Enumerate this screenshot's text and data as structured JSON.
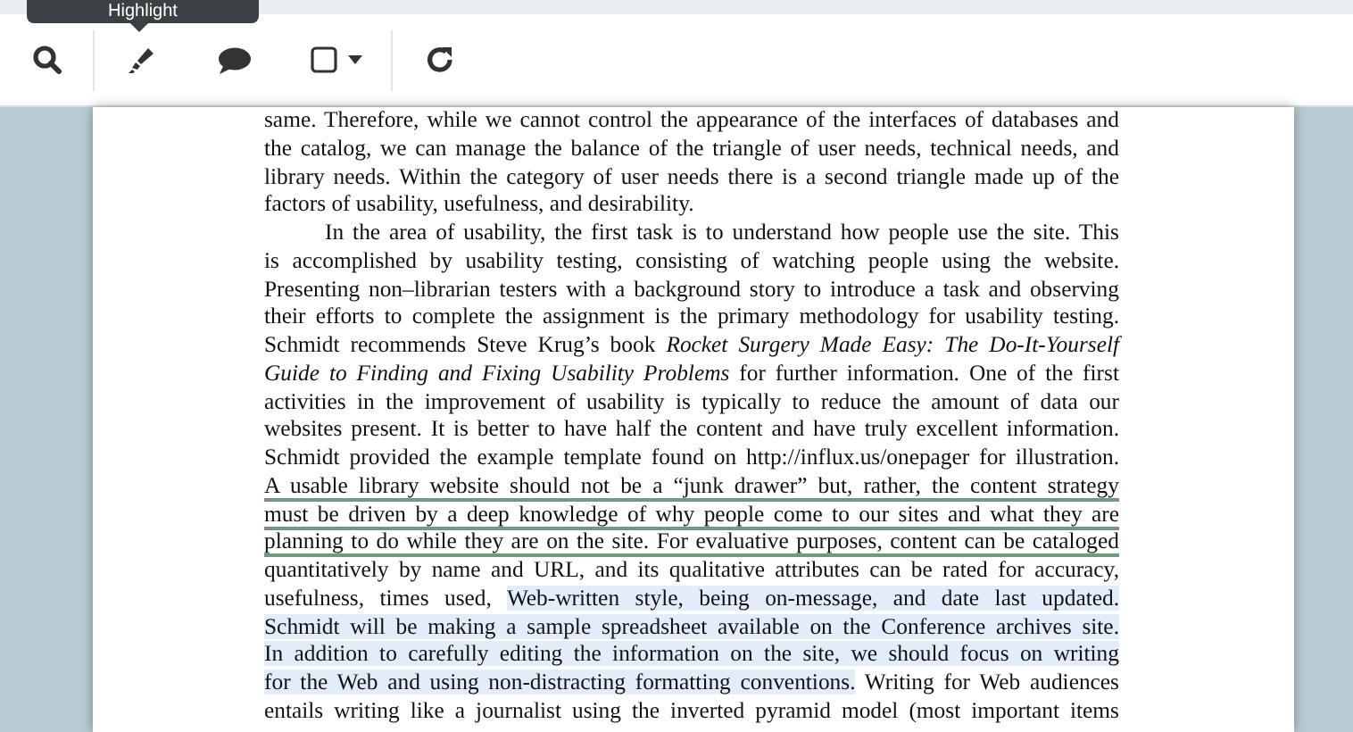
{
  "toolbar": {
    "tools": [
      {
        "kind": "search"
      },
      {
        "kind": "divider"
      },
      {
        "kind": "highlight",
        "tooltip": "Highlight"
      },
      {
        "kind": "comment"
      },
      {
        "kind": "shape"
      },
      {
        "kind": "divider"
      },
      {
        "kind": "refresh"
      }
    ]
  },
  "paragraphs": [
    {
      "indented": false,
      "lines": [
        [
          {
            "text": "same. Therefore, while we cannot control the appearance of the interfaces of databases and"
          }
        ],
        [
          {
            "text": "the catalog, we can manage the balance of the triangle of user needs, technical needs, and"
          }
        ],
        [
          {
            "text": "library needs. Within the category of user needs there is a second triangle made up of the"
          }
        ],
        [
          {
            "text": "factors of usability, usefulness, and desirability."
          }
        ]
      ]
    },
    {
      "indented": true,
      "lines": [
        [
          {
            "text": "In the area of usability, the first task is to understand how people use the site. This"
          }
        ],
        [
          {
            "text": "is accomplished by usability testing, consisting of watching people using the website."
          }
        ],
        [
          {
            "text": "Presenting non–librarian testers with a background story to introduce a task and observing"
          }
        ],
        [
          {
            "text": "their efforts to complete the assignment is the primary methodology for usability testing."
          }
        ],
        [
          {
            "text": "Schmidt recommends Steve Krug’s book *Rocket Surgery Made Easy: The Do-It-Yourself*"
          }
        ],
        [
          {
            "text": "*Guide to Finding and Fixing Usability Problems* for further information. One of the first"
          }
        ],
        [
          {
            "text": "activities in the improvement of usability is typically to reduce the amount of data our"
          }
        ],
        [
          {
            "text": "websites present. It is better to have half the content and have truly excellent information."
          }
        ],
        [
          {
            "text": "Schmidt provided the example template found on http://influx.us/onepager for illustration."
          }
        ],
        [
          {
            "text": "A usable library website should not be a “junk drawer” but, rather, the content strategy",
            "underlined": true
          }
        ],
        [
          {
            "text": "must be driven by a deep knowledge of why people come to our sites and what they are",
            "underlined": true
          }
        ],
        [
          {
            "text": "planning to do while they are on the site. For evaluative purposes, content can be cataloged",
            "underlined": true
          }
        ],
        [
          {
            "text": "quantitatively by name and URL, and its qualitative attributes can be rated for accuracy,"
          }
        ],
        [
          {
            "text": "usefulness, times used, "
          },
          {
            "text": "Web-written style, being on-message, and date last updated.",
            "highlighted": true
          }
        ],
        [
          {
            "text": "Schmidt will be making a sample spreadsheet available on the Conference archives site.",
            "highlighted": true
          }
        ],
        [
          {
            "text": "In addition to carefully editing the information on the site, we should focus on writing",
            "highlighted": true
          }
        ],
        [
          {
            "text": "for the Web and using non-distracting formatting conventions.",
            "highlighted": true
          },
          {
            "text": " Writing for Web audiences"
          }
        ],
        [
          {
            "text": "entails writing like a journalist using the inverted pyramid model (most important items"
          }
        ]
      ]
    }
  ]
}
